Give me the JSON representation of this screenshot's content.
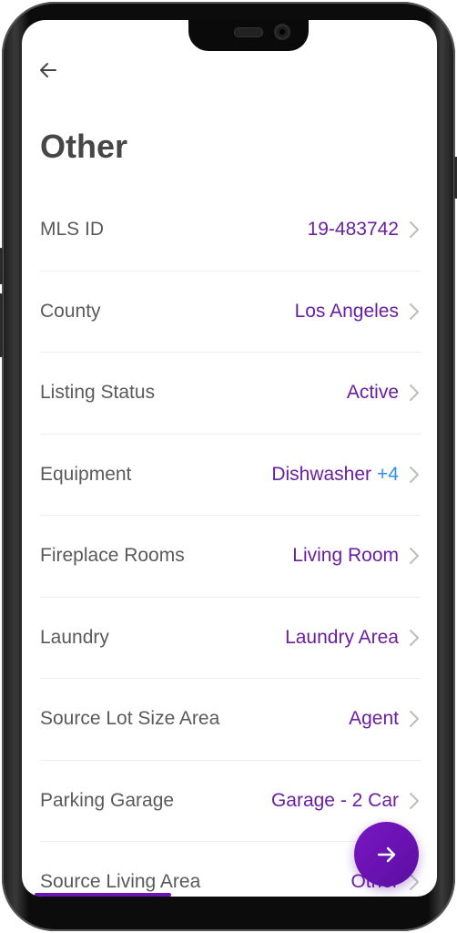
{
  "header": {
    "back_label": "Back",
    "title": "Other"
  },
  "fields": [
    {
      "label": "MLS ID",
      "value": "19-483742",
      "extra": ""
    },
    {
      "label": "County",
      "value": "Los Angeles",
      "extra": ""
    },
    {
      "label": "Listing Status",
      "value": "Active",
      "extra": ""
    },
    {
      "label": "Equipment",
      "value": "Dishwasher",
      "extra": "+4"
    },
    {
      "label": "Fireplace Rooms",
      "value": "Living Room",
      "extra": ""
    },
    {
      "label": "Laundry",
      "value": "Laundry Area",
      "extra": ""
    },
    {
      "label": "Source Lot Size Area",
      "value": "Agent",
      "extra": ""
    },
    {
      "label": "Parking Garage",
      "value": "Garage - 2 Car",
      "extra": ""
    },
    {
      "label": "Source Living Area",
      "value": "Other",
      "extra": ""
    }
  ],
  "fab": {
    "icon": "arrow-right-icon",
    "label": "Next"
  },
  "progress": {
    "fraction": 0.33
  },
  "colors": {
    "accent": "#6a1fa0",
    "extra": "#2f8ff0",
    "fab": "#6e14b8"
  }
}
